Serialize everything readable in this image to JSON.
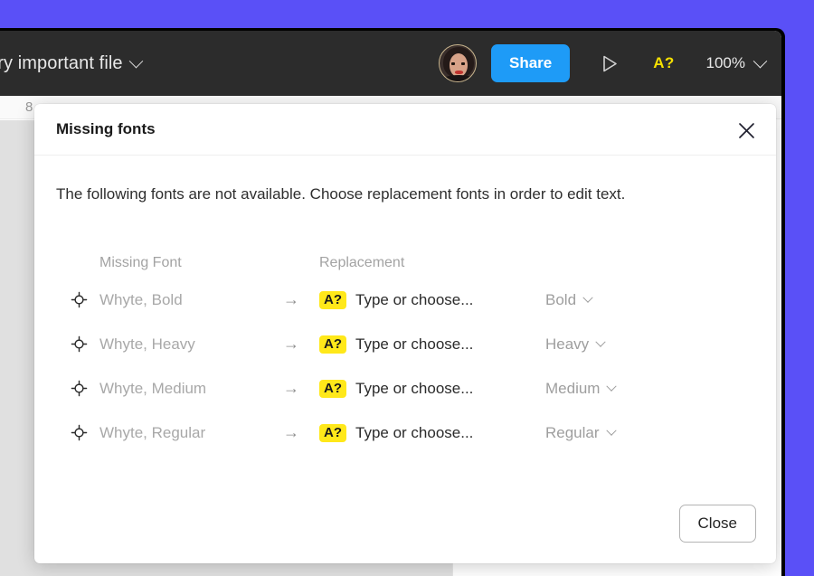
{
  "theme": {
    "desktop_background": "#5a50f7",
    "toolbar_background": "#2c2c2c",
    "accent_blue": "#1e9bf7",
    "warning_yellow": "#f5e000",
    "badge_yellow": "#ffe81a"
  },
  "toolbar": {
    "file_name": "ery important file",
    "file_menu_icon": "chevron-down-icon",
    "avatar_icon": "avatar",
    "share_label": "Share",
    "present_icon": "play-triangle-icon",
    "missing_font_indicator": "A?",
    "zoom_level": "100%",
    "zoom_icon": "chevron-down-icon"
  },
  "canvas": {
    "ruler_label": "8"
  },
  "dialog": {
    "title": "Missing fonts",
    "close_icon": "close-icon",
    "description": "The following fonts are not available. Choose replacement fonts in order to edit text.",
    "columns": {
      "missing": "Missing Font",
      "replacement": "Replacement"
    },
    "rows": [
      {
        "icon": "crosshair-icon",
        "missing_font": "Whyte, Bold",
        "arrow": "→",
        "badge": "A?",
        "replacement_placeholder": "Type or choose...",
        "style": "Bold",
        "style_icon": "chevron-down-icon"
      },
      {
        "icon": "crosshair-icon",
        "missing_font": "Whyte, Heavy",
        "arrow": "→",
        "badge": "A?",
        "replacement_placeholder": "Type or choose...",
        "style": "Heavy",
        "style_icon": "chevron-down-icon"
      },
      {
        "icon": "crosshair-icon",
        "missing_font": "Whyte, Medium",
        "arrow": "→",
        "badge": "A?",
        "replacement_placeholder": "Type or choose...",
        "style": "Medium",
        "style_icon": "chevron-down-icon"
      },
      {
        "icon": "crosshair-icon",
        "missing_font": "Whyte, Regular",
        "arrow": "→",
        "badge": "A?",
        "replacement_placeholder": "Type or choose...",
        "style": "Regular",
        "style_icon": "chevron-down-icon"
      }
    ],
    "close_button_label": "Close"
  }
}
